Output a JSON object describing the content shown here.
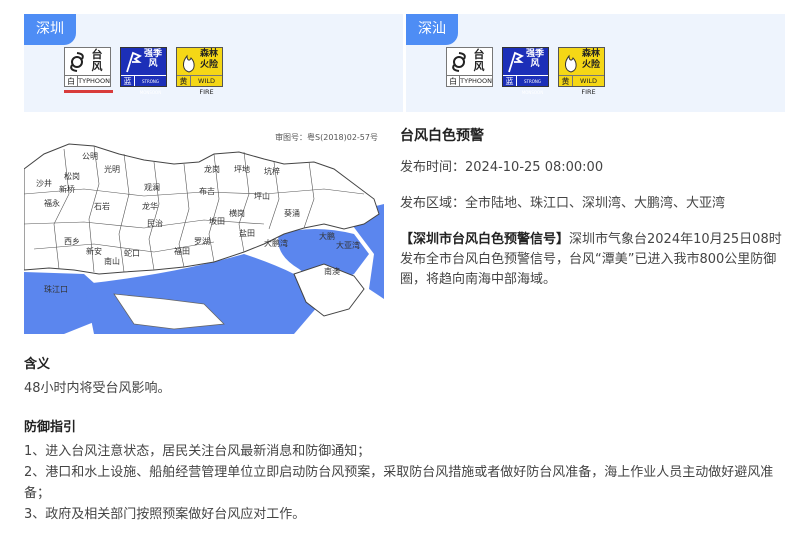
{
  "left_panel": {
    "region": "深圳",
    "icons": [
      {
        "name": "typhoon-white-icon",
        "cjk": "台风",
        "level": "白",
        "en": "TYPHOON",
        "color": "#ffffff"
      },
      {
        "name": "strong-monsoon-blue-icon",
        "cjk": "强季风",
        "level": "蓝",
        "en": "STRONG MONSOON",
        "color": "#1c2fb8"
      },
      {
        "name": "forest-fire-yellow-icon",
        "cjk": "森林火险",
        "level": "黄",
        "en": "WILD FIRE",
        "color": "#f5d716"
      }
    ]
  },
  "right_panel": {
    "region": "深汕",
    "icons": [
      {
        "name": "typhoon-white-icon",
        "cjk": "台风",
        "level": "白",
        "en": "TYPHOON",
        "color": "#ffffff"
      },
      {
        "name": "strong-monsoon-blue-icon",
        "cjk": "强季风",
        "level": "蓝",
        "en": "STRONG MONSOON",
        "color": "#1c2fb8"
      },
      {
        "name": "forest-fire-yellow-icon",
        "cjk": "森林火险",
        "level": "黄",
        "en": "WILD FIRE",
        "color": "#f5d716"
      }
    ]
  },
  "map": {
    "caption": "审图号：粤S(2018)02-57号",
    "places": [
      "公明",
      "光明",
      "沙井",
      "松岗",
      "新桥",
      "福永",
      "石岩",
      "观澜",
      "龙华",
      "民治",
      "西乡",
      "新安",
      "南山",
      "蛇口",
      "福田",
      "罗湖",
      "盐田",
      "坪山",
      "龙岗",
      "坑梓",
      "葵涌",
      "大鹏",
      "南澳",
      "大鹏湾",
      "大亚湾",
      "珠江口",
      "布吉",
      "横岗",
      "坪地",
      "沙头",
      "梅林",
      "南湾",
      "坂田",
      "吉华",
      "园山",
      "宝龙"
    ]
  },
  "detail": {
    "title": "台风白色预警",
    "time_label": "发布时间：",
    "time_value": "2024-10-25 08:00:00",
    "area_label": "发布区域：",
    "area_value": "全市陆地、珠江口、深圳湾、大鹏湾、大亚湾",
    "desc_bracket": "【深圳市台风白色预警信号】",
    "desc_text": "深圳市气象台2024年10月25日08时发布全市台风白色预警信号，台风“潭美”已进入我市800公里防御圈，将趋向南海中部海域。"
  },
  "meaning": {
    "heading": "含义",
    "text": "48小时内将受台风影响。"
  },
  "guide": {
    "heading": "防御指引",
    "items": [
      "1、进入台风注意状态，居民关注台风最新消息和防御通知；",
      "2、港口和水上设施、船舶经营管理单位立即启动防台风预案，采取防台风措施或者做好防台风准备，海上作业人员主动做好避风准备；",
      "3、政府及相关部门按照预案做好台风应对工作。"
    ]
  }
}
